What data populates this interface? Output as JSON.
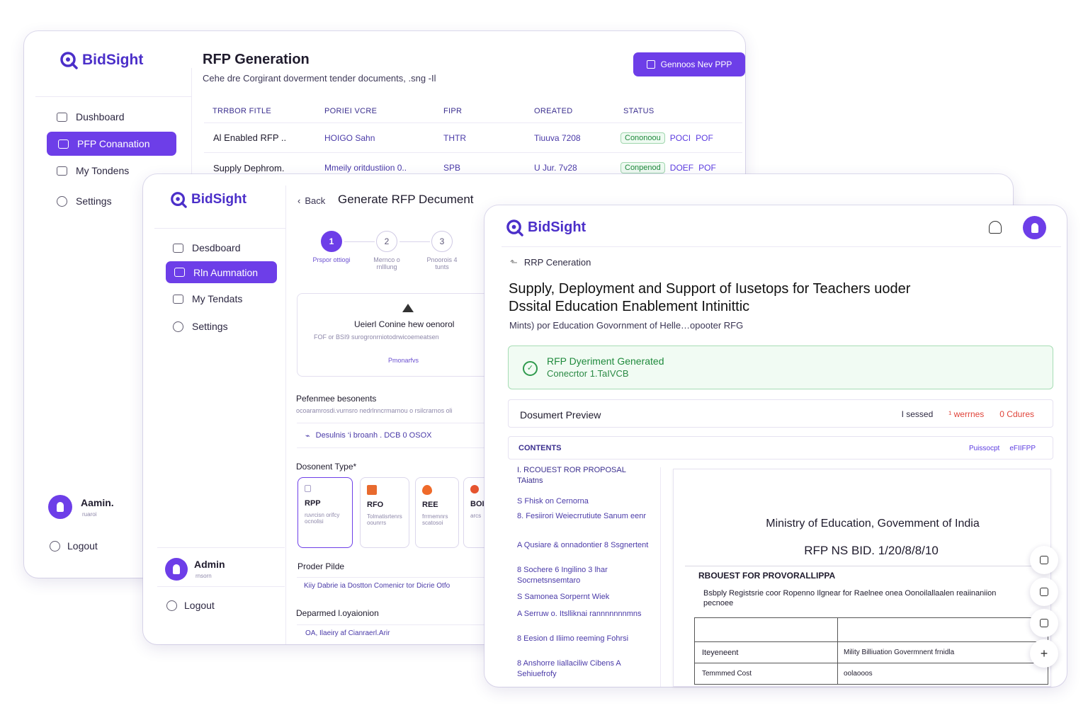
{
  "brand": "BidSight",
  "colors": {
    "accent": "#6d3ee8",
    "success": "#1f8a3c",
    "warning": "#e0443a"
  },
  "w1": {
    "title": "RFP Generation",
    "subtitle": "Cehe dre Corgirant doverment tender documents, .sng -Il",
    "cta": "Gennoos Nev PPP",
    "nav": [
      "Dushboard",
      "PFP Conanation",
      "My Tondens",
      "Settings"
    ],
    "user": "Aamin.",
    "user_sub": "ruaroi",
    "logout": "Logout",
    "table": {
      "headers": [
        "TRRBOR FITLE",
        "PORIEI VCRE",
        "FIPR",
        "OREATED",
        "STATUS"
      ],
      "rows": [
        {
          "title": "Al Enabled RFP ..",
          "dept": "HOIGO  Sahn",
          "type": "THTR",
          "created": "Tiuuva 7208",
          "status": "Cononoou",
          "a1": "POCI",
          "a2": "POF"
        },
        {
          "title": "Supply Dephrom.",
          "dept": "Mmeily oritdustiion  0..",
          "type": "SPB",
          "created": "U Jur. 7v28",
          "status": "Conpenod",
          "a1": "DOEF",
          "a2": "POF"
        }
      ]
    }
  },
  "w2": {
    "back": "Back",
    "title": "Generate RFP Decument",
    "nav": [
      "Desdboard",
      "Rln Aumnation",
      "My Tendats",
      "Settings"
    ],
    "steps": [
      {
        "num": "1",
        "label": "Prspor ottiogi"
      },
      {
        "num": "2",
        "label": "Mernco o rnlllung"
      },
      {
        "num": "3",
        "label": "Pnoorois 4 tunts"
      }
    ],
    "upload_title": "Ueierl Conine hew oenorol",
    "upload_sub": "FOF or BSI9  surogronrniotodrwicoemeatsen",
    "upload_link": "Pmonarfvs",
    "ref_title": "Pefenmee besonents",
    "ref_sub": "ocoaramrosdi.vurnsro nedrlnncrmarnou  o rsilcrarnos  oli",
    "ref_file": "Desulnis ‘i broanh . DCB 0 OSOX",
    "doctype_label": "Dosonent Type*",
    "types": [
      {
        "name": "RPP",
        "desc": "ruvrcisn orifcy ocnolisi"
      },
      {
        "name": "RFO",
        "desc": "Tolmatisrtenrs oounrrs"
      },
      {
        "name": "REE",
        "desc": "frrmemnrs scatosoi"
      },
      {
        "name": "BOI",
        "desc": "arcs"
      }
    ],
    "tender_label": "Proder Pilde",
    "tender_value": "Kiiy Dabrie ia Dostton Comenicr tor Dicrie Otfo",
    "dept_label": "Deparmed l.oyaionion",
    "dept_value": "OA, Ilaeiry af Cianraerl.Arir",
    "user": "Admin",
    "user_sub": "rnsorn",
    "logout": "Logout"
  },
  "w3": {
    "breadcrumb": "RRP Ceneration",
    "title_l1": "Supply, Deployment and Support of Iusetops for Teachers uoder",
    "title_l2": "Dssital Education Enablement Intinittic",
    "subtitle": "Mints) por Education Govornment of Helle…opooter RFG",
    "alert_title": "RFP Dyeriment Generated",
    "alert_sub": "Conecrtor 1.TaIVCB",
    "preview_title": "Dosumert Preview",
    "preview_meta": [
      "I sessed",
      "¹ werrnes",
      "0 Cdures"
    ],
    "contents_title": "CONTENTS",
    "contents_actions": [
      "Puissocpt",
      "eFIIFPP"
    ],
    "toc": [
      "I. RCOUEST ROR PROPOSAL TAiatns",
      "S  Fhisk on Cernorna",
      "8. Fesiirori Weiecrrutiute Sanum eenr",
      "A Qusiare & onnadontier 8 Ssgnertent",
      "8  Sochere 6 Ingilino 3 lhar Socrnetsnsemtaro",
      "S  Samonea Sorpernt Wiek",
      "A  Serruw o. Itslliknai rannnnnnnmns",
      "8  Eesion d Iliimo reeming Fohrsi",
      "8  Anshorre Iiallaciliw Cibens A Sehiuefrofy"
    ],
    "doc": {
      "ministry": "Ministry of Education, Govemment of India",
      "rfpno": "RFP NS BID. 1/20/8/8/10",
      "section": "RBOUEST FOR PROVORALLIPPA",
      "desc": "Bsbply Registsrie coor Ropenno Ilgnear for Raelnee onea Oonoilallaalen reaiinaniion pecnoee",
      "rows": [
        {
          "k": "",
          "v": ""
        },
        {
          "k": "Iteyeneent",
          "v": "Mility Billiuation Govermnent frnidla"
        },
        {
          "k": "Temmmed Cost",
          "v": "oolaooos"
        }
      ]
    }
  }
}
